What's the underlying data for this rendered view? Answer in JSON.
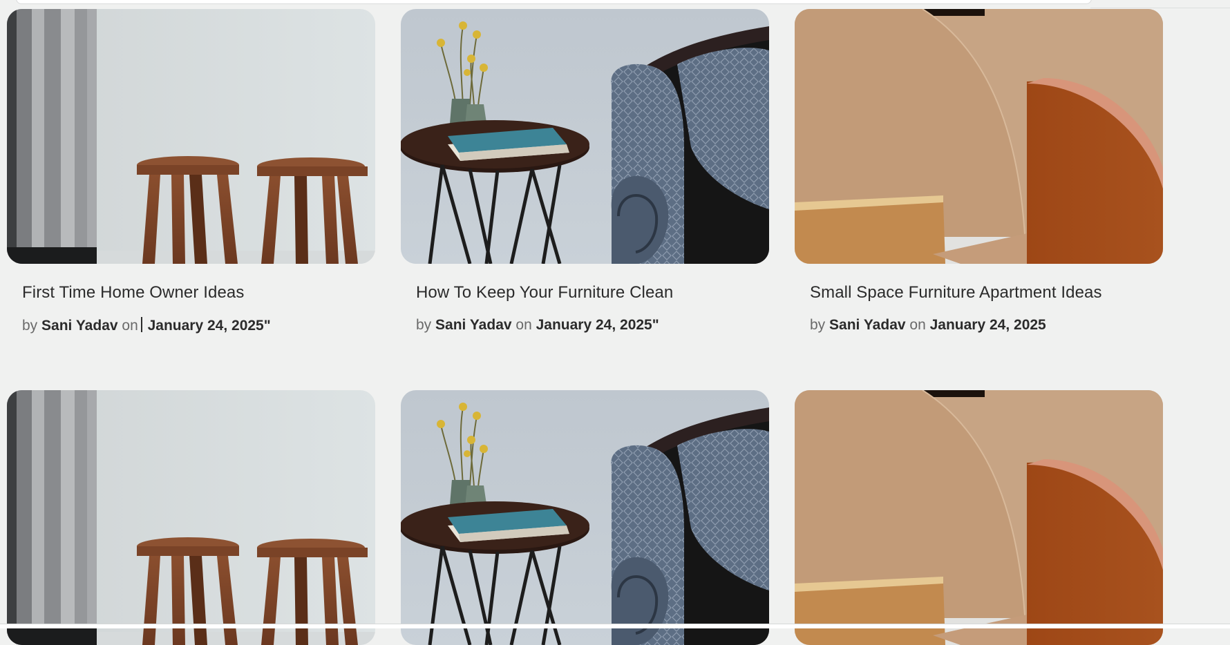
{
  "posts": [
    {
      "title": "First Time Home Owner Ideas",
      "by": "by",
      "author": "Sani Yadav",
      "on": "on",
      "date": "January 24, 2025\"",
      "image_icon": "stools-photo"
    },
    {
      "title": "How To Keep Your Furniture Clean",
      "by": "by",
      "author": "Sani Yadav",
      "on": "on",
      "date": "January 24, 2025\"",
      "image_icon": "side-table-photo"
    },
    {
      "title": "Small Space Furniture Apartment Ideas",
      "by": "by",
      "author": "Sani Yadav",
      "on": "on",
      "date": "January 24, 2025",
      "image_icon": "arches-photo"
    },
    {
      "image_icon": "stools-photo"
    },
    {
      "image_icon": "side-table-photo"
    },
    {
      "image_icon": "arches-photo"
    }
  ],
  "colors": {
    "page_background": "#f0f1f0",
    "title_text": "#2b2b2b",
    "meta_text": "#6a6a6a"
  }
}
